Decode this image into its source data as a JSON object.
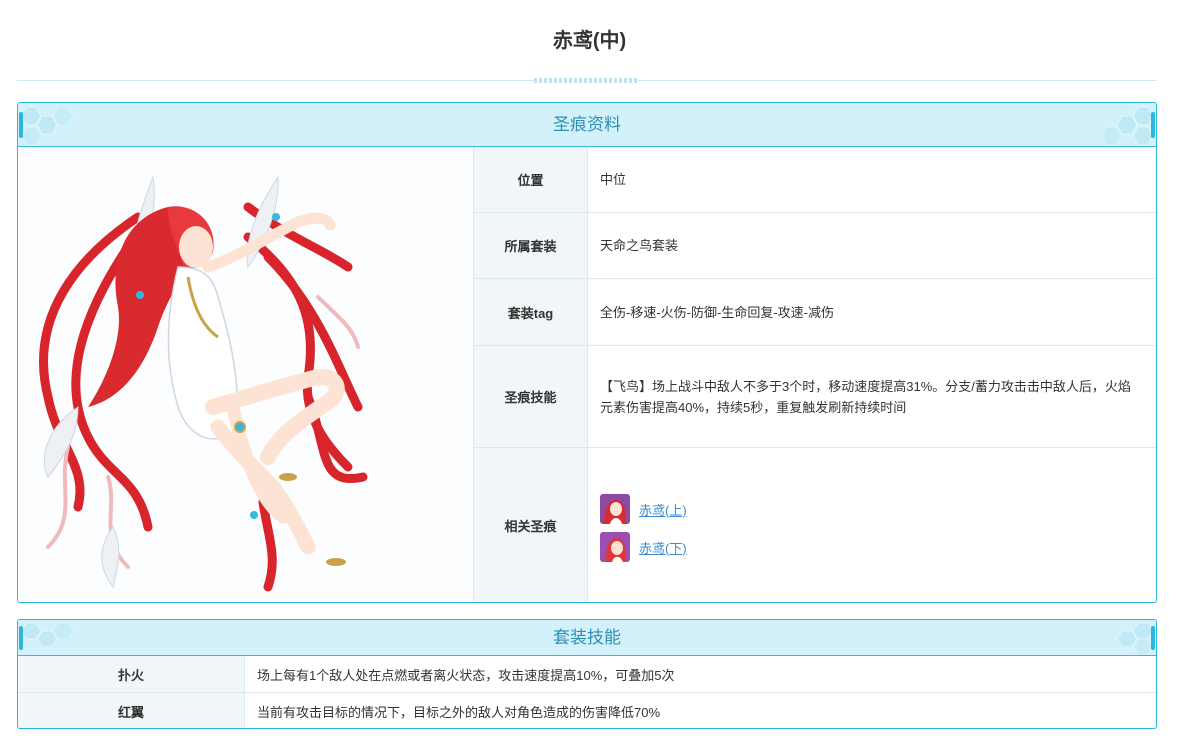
{
  "page": {
    "title": "赤鸢(中)"
  },
  "info_panel": {
    "title": "圣痕资料",
    "rows": [
      {
        "key": "位置",
        "value": "中位"
      },
      {
        "key": "所属套装",
        "value": "天命之鸟套装"
      },
      {
        "key": "套装tag",
        "value": "全伤-移速-火伤-防御-生命回复-攻速-减伤"
      },
      {
        "key": "圣痕技能",
        "value": "【飞鸟】场上战斗中敌人不多于3个时，移动速度提高31%。分支/蓄力攻击击中敌人后，火焰元素伤害提高40%，持续5秒，重复触发刷新持续时间"
      },
      {
        "key": "相关圣痕"
      }
    ],
    "related": [
      {
        "label": "赤鸢(上)"
      },
      {
        "label": "赤鸢(下)"
      }
    ]
  },
  "set_panel": {
    "title": "套装技能",
    "rows": [
      {
        "key": "扑火",
        "value": "场上每有1个敌人处在点燃或者离火状态，攻击速度提高10%，可叠加5次"
      },
      {
        "key": "红翼",
        "value": "当前有攻击目标的情况下，目标之外的敌人对角色造成的伤害降低70%"
      }
    ]
  },
  "colors": {
    "accent": "#2bb5da",
    "header_bg": "#d2f1fa",
    "header_text": "#2e8fb4",
    "link": "#3c8ccd"
  }
}
